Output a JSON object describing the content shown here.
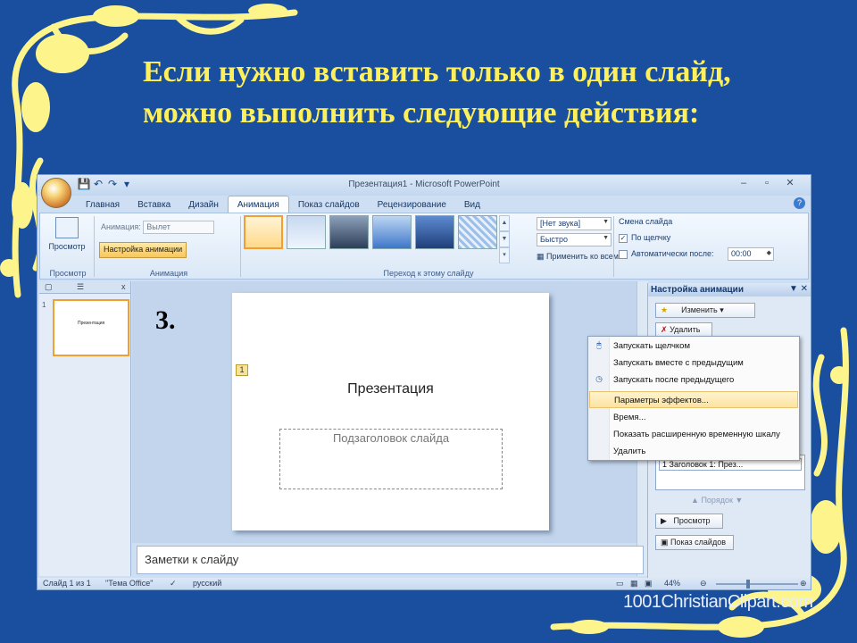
{
  "heading": {
    "line1": "Если нужно вставить только в один слайд,",
    "line2": "можно  выполнить следующие действия:"
  },
  "step_number": "3.",
  "window": {
    "title": "Презентация1 - Microsoft PowerPoint",
    "controls": [
      "–",
      "▫",
      "✕"
    ]
  },
  "ribbon_tabs": [
    {
      "label": "Главная"
    },
    {
      "label": "Вставка"
    },
    {
      "label": "Дизайн"
    },
    {
      "label": "Анимация",
      "active": true
    },
    {
      "label": "Показ слайдов"
    },
    {
      "label": "Рецензирование"
    },
    {
      "label": "Вид"
    }
  ],
  "ribbon": {
    "preview": {
      "label": "Просмотр",
      "group": "Просмотр"
    },
    "animation": {
      "label": "Анимация:",
      "value": "Вылет",
      "setup_button": "Настройка анимации",
      "group": "Анимация"
    },
    "transition": {
      "sound": "[Нет звука]",
      "speed": "Быстро",
      "apply_all": "Применить ко всем",
      "group": "Переход к этому слайду"
    },
    "advance": {
      "title": "Смена слайда",
      "on_click": "По щелчку",
      "on_click_checked": true,
      "auto_after": "Автоматически после:",
      "auto_checked": false,
      "time": "00:00"
    }
  },
  "slides_panel": {
    "close": "x",
    "slide_number": "1",
    "thumb_title": "Презентация"
  },
  "slide": {
    "anim_tag": "1",
    "title": "Презентация",
    "subtitle_placeholder": "Подзаголовок слайда"
  },
  "notes_placeholder": "Заметки к слайду",
  "task_pane": {
    "title": "Настройка анимации",
    "change_button": "Изменить",
    "remove_button": "Удалить",
    "list_item": "1   Заголовок 1: През...",
    "order_label": "Порядок",
    "play_button": "Просмотр",
    "slideshow_button": "Показ слайдов"
  },
  "context_menu": [
    {
      "label": "Запускать щелчком",
      "icon": "mouse-icon"
    },
    {
      "label": "Запускать вместе с предыдущим",
      "icon": ""
    },
    {
      "label": "Запускать после предыдущего",
      "icon": "clock-icon"
    },
    {
      "label": "Параметры эффектов...",
      "icon": "",
      "highlighted": true
    },
    {
      "label": "Время...",
      "icon": ""
    },
    {
      "label": "Показать расширенную временную шкалу",
      "icon": ""
    },
    {
      "label": "Удалить",
      "icon": ""
    }
  ],
  "statusbar": {
    "slide_info": "Слайд 1 из 1",
    "theme": "\"Тема Office\"",
    "language": "русский",
    "zoom": "44%"
  },
  "watermark": "1001ChristianClipart.com",
  "colors": {
    "background": "#1a4fa0",
    "heading": "#fdf05a",
    "ornament": "#fdf58c",
    "highlight": "#fde3a0"
  }
}
